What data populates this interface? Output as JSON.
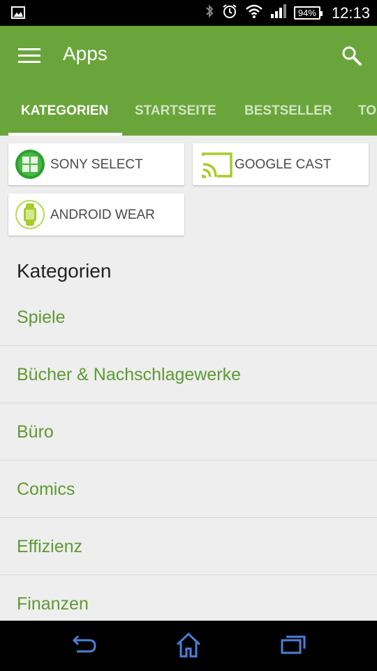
{
  "status_bar": {
    "battery": "94%",
    "time": "12:13",
    "icons": [
      "image-icon",
      "bluetooth-icon",
      "alarm-icon",
      "wifi-icon",
      "signal-icon",
      "battery-icon"
    ]
  },
  "appbar": {
    "title": "Apps",
    "color": "#6aa53b"
  },
  "tabs": [
    {
      "label": "KATEGORIEN",
      "active": true
    },
    {
      "label": "STARTSEITE",
      "active": false
    },
    {
      "label": "BESTSELLER",
      "active": false
    },
    {
      "label": "TO",
      "active": false
    }
  ],
  "featured": [
    {
      "label": "SONY SELECT",
      "icon": "sony-select-icon"
    },
    {
      "label": "GOOGLE CAST",
      "icon": "cast-icon"
    },
    {
      "label": "ANDROID WEAR",
      "icon": "watch-icon"
    }
  ],
  "section_title": "Kategorien",
  "categories": [
    "Spiele",
    "Bücher & Nachschlagewerke",
    "Büro",
    "Comics",
    "Effizienz",
    "Finanzen"
  ],
  "accent_color": "#5e9a31",
  "nav": [
    "back-icon",
    "home-icon",
    "recent-apps-icon"
  ]
}
